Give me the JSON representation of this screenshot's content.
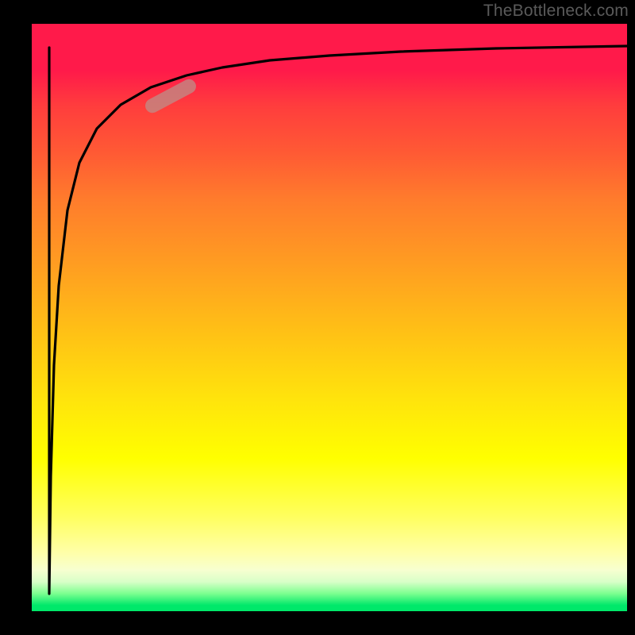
{
  "watermark": "TheBottleneck.com",
  "colors": {
    "page_bg": "#000000",
    "gradient_top": "#ff1a4a",
    "gradient_mid_orange": "#ff9a22",
    "gradient_yellow": "#ffff00",
    "gradient_bottom": "#00e86a",
    "curve": "#000000",
    "marker": "#c08a85"
  },
  "chart_data": {
    "type": "line",
    "title": "",
    "xlabel": "",
    "ylabel": "",
    "xlim": [
      0,
      100
    ],
    "ylim": [
      0,
      100
    ],
    "grid": false,
    "series": [
      {
        "name": "curve",
        "x": [
          3,
          3.2,
          3.8,
          4.5,
          6,
          8,
          11,
          15,
          20,
          26,
          32,
          40,
          50,
          62,
          78,
          100
        ],
        "y": [
          3,
          20,
          40,
          55,
          68,
          76,
          82,
          86,
          89,
          91,
          92.5,
          93.5,
          94.3,
          95,
          95.5,
          96
        ]
      }
    ],
    "marker": {
      "x_center": 23.5,
      "y_center": 88,
      "length_pct": 8,
      "angle_deg": 28
    }
  }
}
